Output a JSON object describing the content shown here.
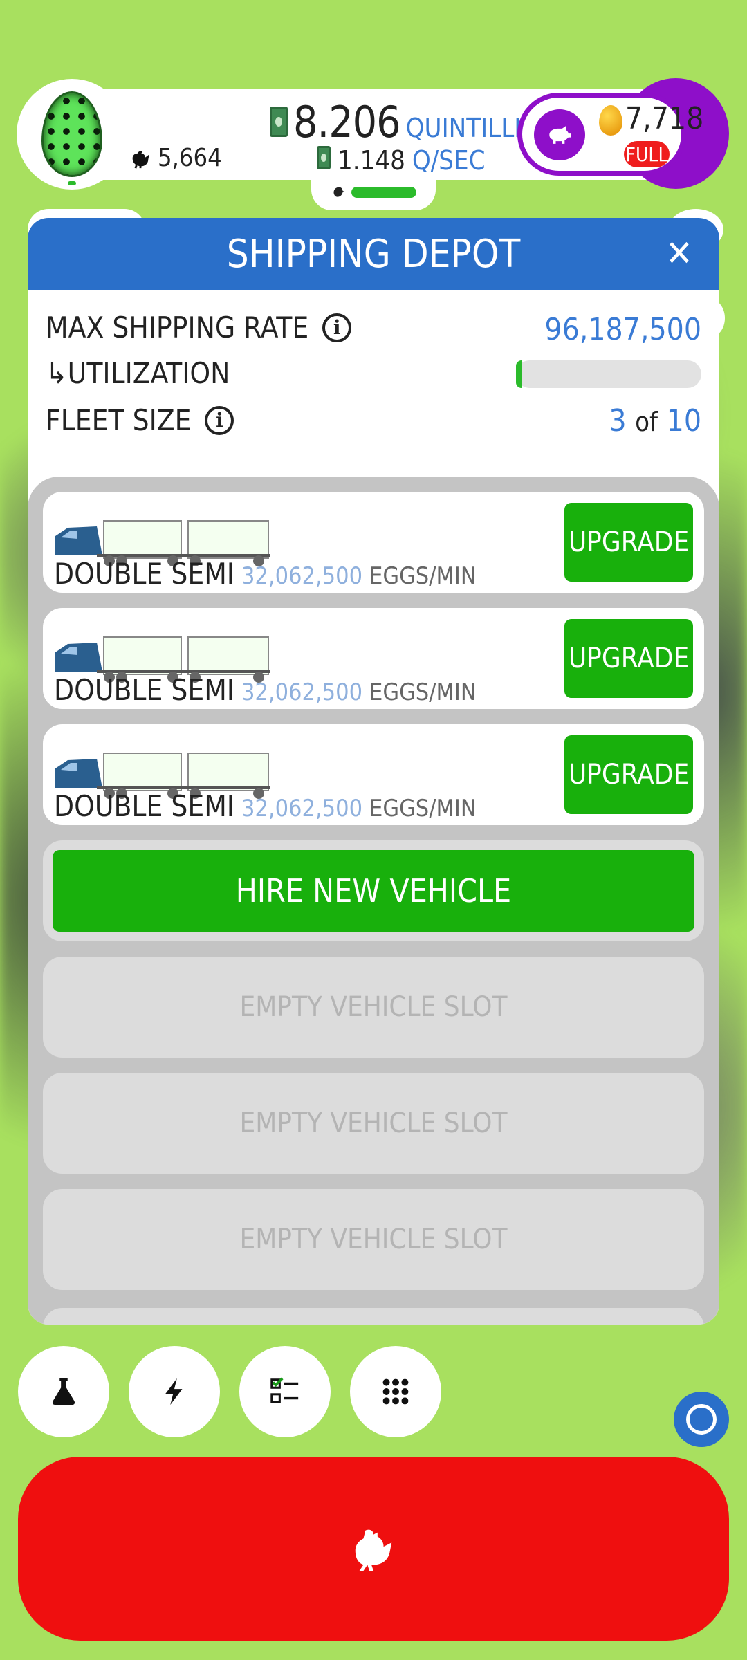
{
  "hud": {
    "chicken_count": "5,664",
    "money_value": "8.206",
    "money_unit": "QUINTILLION",
    "rate_value": "1.148",
    "rate_unit": "Q/SEC",
    "golden_eggs": "7,718",
    "piggy_status": "FULL"
  },
  "dialog": {
    "title": "SHIPPING DEPOT",
    "max_shipping_label": "MAX SHIPPING RATE",
    "max_shipping_value": "96,187,500",
    "utilization_label": "↳UTILIZATION",
    "utilization_fraction": 0.03,
    "fleet_label": "FLEET SIZE",
    "fleet_current": "3",
    "fleet_of": "of",
    "fleet_max": "10"
  },
  "vehicles": [
    {
      "name": "DOUBLE SEMI",
      "rate": "32,062,500",
      "unit": "EGGS/MIN",
      "button": "UPGRADE"
    },
    {
      "name": "DOUBLE SEMI",
      "rate": "32,062,500",
      "unit": "EGGS/MIN",
      "button": "UPGRADE"
    },
    {
      "name": "DOUBLE SEMI",
      "rate": "32,062,500",
      "unit": "EGGS/MIN",
      "button": "UPGRADE"
    }
  ],
  "hire_button": "HIRE NEW VEHICLE",
  "empty_slots": [
    "EMPTY VEHICLE SLOT",
    "EMPTY VEHICLE SLOT",
    "EMPTY VEHICLE SLOT"
  ],
  "bottom_buttons": [
    "flask-icon",
    "lightning-icon",
    "checklist-icon",
    "grid-icon"
  ],
  "colors": {
    "background": "#a8e05f",
    "header_blue": "#2a6fc9",
    "button_green": "#18b00c",
    "accent_blue": "#3a7bd5",
    "hatch_red": "#ef0f0f",
    "piggy_purple": "#8e0fc9"
  }
}
